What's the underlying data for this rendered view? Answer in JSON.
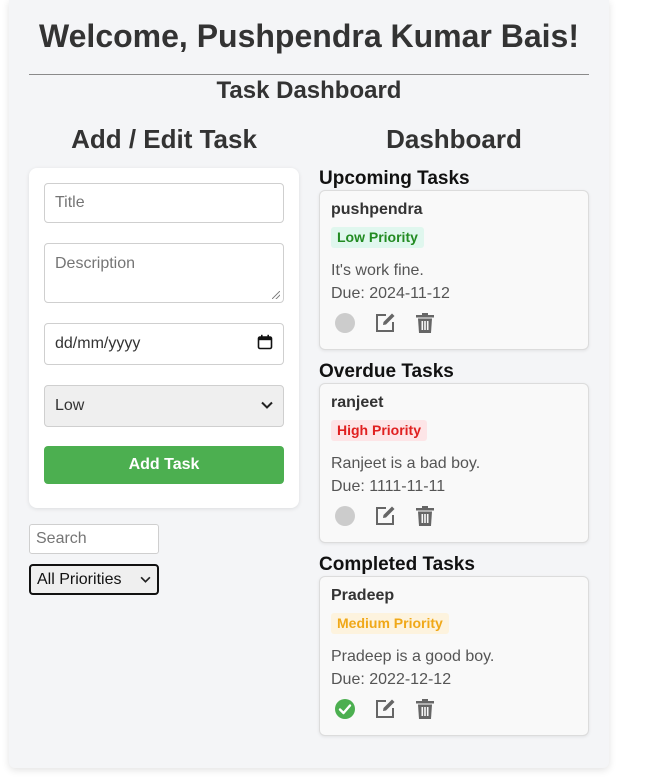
{
  "header": {
    "welcome": "Welcome, Pushpendra Kumar Bais!",
    "dashboard_title": "Task Dashboard"
  },
  "form": {
    "heading": "Add / Edit Task",
    "title_placeholder": "Title",
    "description_placeholder": "Description",
    "date_placeholder": "dd/mm/yyyy",
    "priority_value": "Low",
    "submit_label": "Add Task"
  },
  "filters": {
    "search_placeholder": "Search",
    "priority_filter": "All Priorities"
  },
  "dashboard": {
    "heading": "Dashboard",
    "sections": [
      {
        "title": "Upcoming Tasks",
        "task": {
          "title": "pushpendra",
          "priority": "Low Priority",
          "priority_color": "#228b22",
          "priority_bg": "#e0f7ee",
          "description": "It's work fine.",
          "due": "Due: 2024-11-12",
          "completed": false
        }
      },
      {
        "title": "Overdue Tasks",
        "task": {
          "title": "ranjeet",
          "priority": "High Priority",
          "priority_color": "#e02020",
          "priority_bg": "#fde5e7",
          "description": "Ranjeet is a bad boy.",
          "due": "Due: 1111-11-11",
          "completed": false
        }
      },
      {
        "title": "Completed Tasks",
        "task": {
          "title": "Pradeep",
          "priority": "Medium Priority",
          "priority_color": "#f0a818",
          "priority_bg": "#fdf3de",
          "description": "Pradeep is a good boy.",
          "due": "Due: 2022-12-12",
          "completed": true
        }
      }
    ]
  },
  "colors": {
    "accent_green": "#4caf50",
    "icon_gray": "#666666",
    "pending_circle": "#cccccc"
  },
  "icons": {
    "status_pending": "circle-icon",
    "status_done": "check-circle-icon",
    "edit": "edit-icon",
    "delete": "trash-icon"
  }
}
